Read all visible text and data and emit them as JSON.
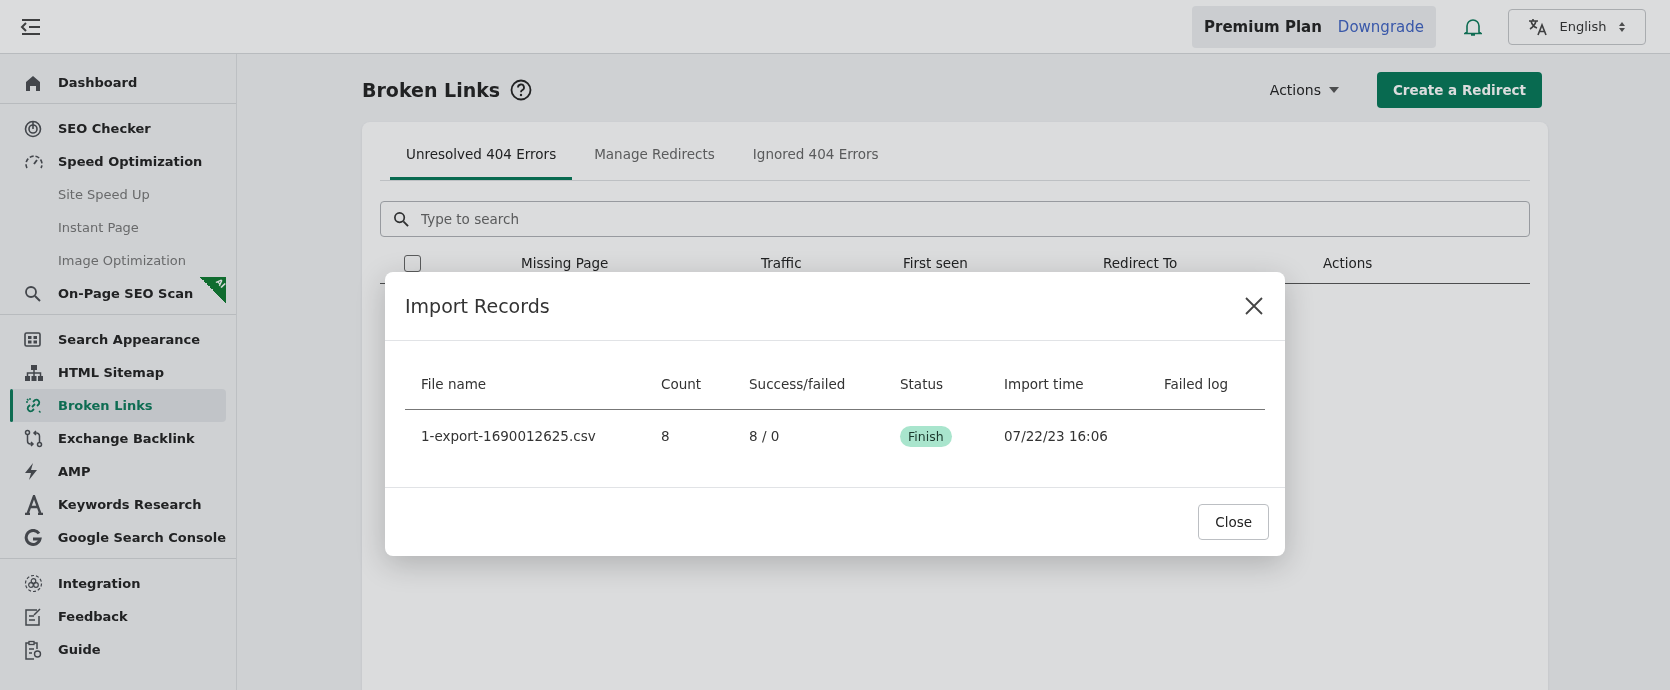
{
  "topbar": {
    "plan": "Premium Plan",
    "plan_link": "Downgrade",
    "language": "English"
  },
  "sidebar": {
    "groups": [
      [
        {
          "label": "Dashboard",
          "kind": "main",
          "selected": false
        }
      ],
      [
        {
          "label": "SEO Checker",
          "kind": "main",
          "selected": false
        },
        {
          "label": "Speed Optimization",
          "kind": "main",
          "selected": false
        },
        {
          "label": "Site Speed Up",
          "kind": "sub",
          "selected": false
        },
        {
          "label": "Instant Page",
          "kind": "sub",
          "selected": false
        },
        {
          "label": "Image Optimization",
          "kind": "sub",
          "selected": false
        },
        {
          "label": "On-Page SEO Scan",
          "kind": "main",
          "selected": false,
          "badge": "AI"
        }
      ],
      [
        {
          "label": "Search Appearance",
          "kind": "main",
          "selected": false
        },
        {
          "label": "HTML Sitemap",
          "kind": "main",
          "selected": false
        },
        {
          "label": "Broken Links",
          "kind": "main",
          "selected": true
        },
        {
          "label": "Exchange Backlink",
          "kind": "main",
          "selected": false
        },
        {
          "label": "AMP",
          "kind": "main",
          "selected": false
        },
        {
          "label": "Keywords Research",
          "kind": "main",
          "selected": false
        },
        {
          "label": "Google Search Console",
          "kind": "main",
          "selected": false
        }
      ],
      [
        {
          "label": "Integration",
          "kind": "main",
          "selected": false
        },
        {
          "label": "Feedback",
          "kind": "main",
          "selected": false
        },
        {
          "label": "Guide",
          "kind": "main",
          "selected": false
        }
      ]
    ]
  },
  "page": {
    "title": "Broken Links",
    "actions": "Actions",
    "create_button": "Create a Redirect",
    "tabs": [
      {
        "label": "Unresolved 404 Errors",
        "selected": true
      },
      {
        "label": "Manage Redirects",
        "selected": false
      },
      {
        "label": "Ignored 404 Errors",
        "selected": false
      }
    ],
    "search": {
      "placeholder": "Type to search"
    },
    "table": {
      "select_all_checked": false,
      "columns": [
        "Missing Page",
        "Traffic",
        "First seen",
        "Redirect To",
        "Actions"
      ]
    }
  },
  "modal": {
    "title": "Import Records",
    "columns": [
      "File name",
      "Count",
      "Success/failed",
      "Status",
      "Import time",
      "Failed log"
    ],
    "rows": [
      {
        "file_name": "1-export-1690012625.csv",
        "count": "8",
        "success_failed": "8 / 0",
        "status": "Finish",
        "import_time": "07/22/23 16:06"
      }
    ],
    "close_button": "Close"
  }
}
